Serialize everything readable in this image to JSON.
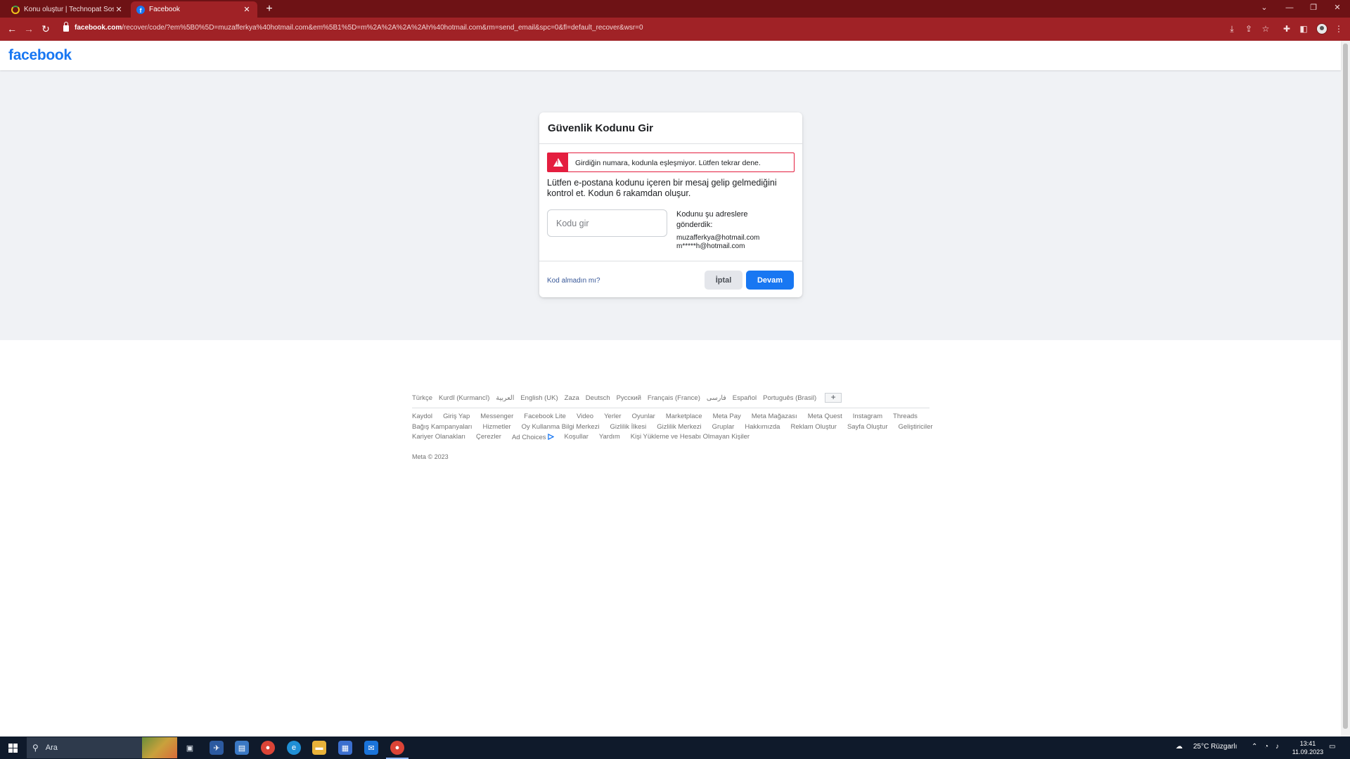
{
  "browser": {
    "tabs": [
      {
        "title": "Konu oluştur | Technopat Sosyal",
        "icon": "technopat-favicon"
      },
      {
        "title": "Facebook",
        "icon": "facebook-favicon",
        "active": true
      }
    ],
    "new_tab": "+",
    "url_host": "facebook.com",
    "url_rest": "/recover/code/?em%5B0%5D=muzafferkya%40hotmail.com&em%5B1%5D=m%2A%2A%2A%2Ah%40hotmail.com&rm=send_email&spc=0&fl=default_recover&wsr=0",
    "colors": {
      "tabbar": "#6e1215",
      "toolbar": "#a02226"
    }
  },
  "facebook": {
    "logo": "facebook",
    "brand_color": "#1877f2",
    "card": {
      "title": "Güvenlik Kodunu Gir",
      "error": "Girdiğin numara, kodunla eşleşmiyor. Lütfen tekrar dene.",
      "instructions": "Lütfen e-postana kodunu içeren bir mesaj gelip gelmediğini kontrol et. Kodun 6 rakamdan oluşur.",
      "code_placeholder": "Kodu gir",
      "code_value": "",
      "sent_label": "Kodunu şu adreslere gönderdik:",
      "emails": [
        "muzafferkya@hotmail.com",
        "m*****h@hotmail.com"
      ],
      "no_code_link": "Kod almadın mı?",
      "cancel": "İptal",
      "continue": "Devam"
    },
    "footer": {
      "languages": [
        "Türkçe",
        "Kurdî (Kurmancî)",
        "العربية",
        "English (UK)",
        "Zaza",
        "Deutsch",
        "Русский",
        "Français (France)",
        "فارسی",
        "Español",
        "Português (Brasil)"
      ],
      "more_languages": "+",
      "links_row1": [
        "Kaydol",
        "Giriş Yap",
        "Messenger",
        "Facebook Lite",
        "Video",
        "Yerler",
        "Oyunlar",
        "Marketplace",
        "Meta Pay",
        "Meta Mağazası",
        "Meta Quest",
        "Instagram",
        "Threads"
      ],
      "links_row2": [
        "Bağış Kampanyaları",
        "Hizmetler",
        "Oy Kullanma Bilgi Merkezi",
        "Gizlilik İlkesi",
        "Gizlilik Merkezi",
        "Gruplar",
        "Hakkımızda",
        "Reklam Oluştur",
        "Sayfa Oluştur",
        "Geliştiriciler"
      ],
      "links_row3": [
        "Kariyer Olanakları",
        "Çerezler",
        "Ad Choices",
        "Koşullar",
        "Yardım",
        "Kişi Yükleme ve Hesabı Olmayan Kişiler"
      ],
      "copyright": "Meta © 2023"
    }
  },
  "taskbar": {
    "search_placeholder": "Ara",
    "weather": "25°C  Rüzgarlı",
    "time": "13:41",
    "date": "11.09.2023"
  }
}
